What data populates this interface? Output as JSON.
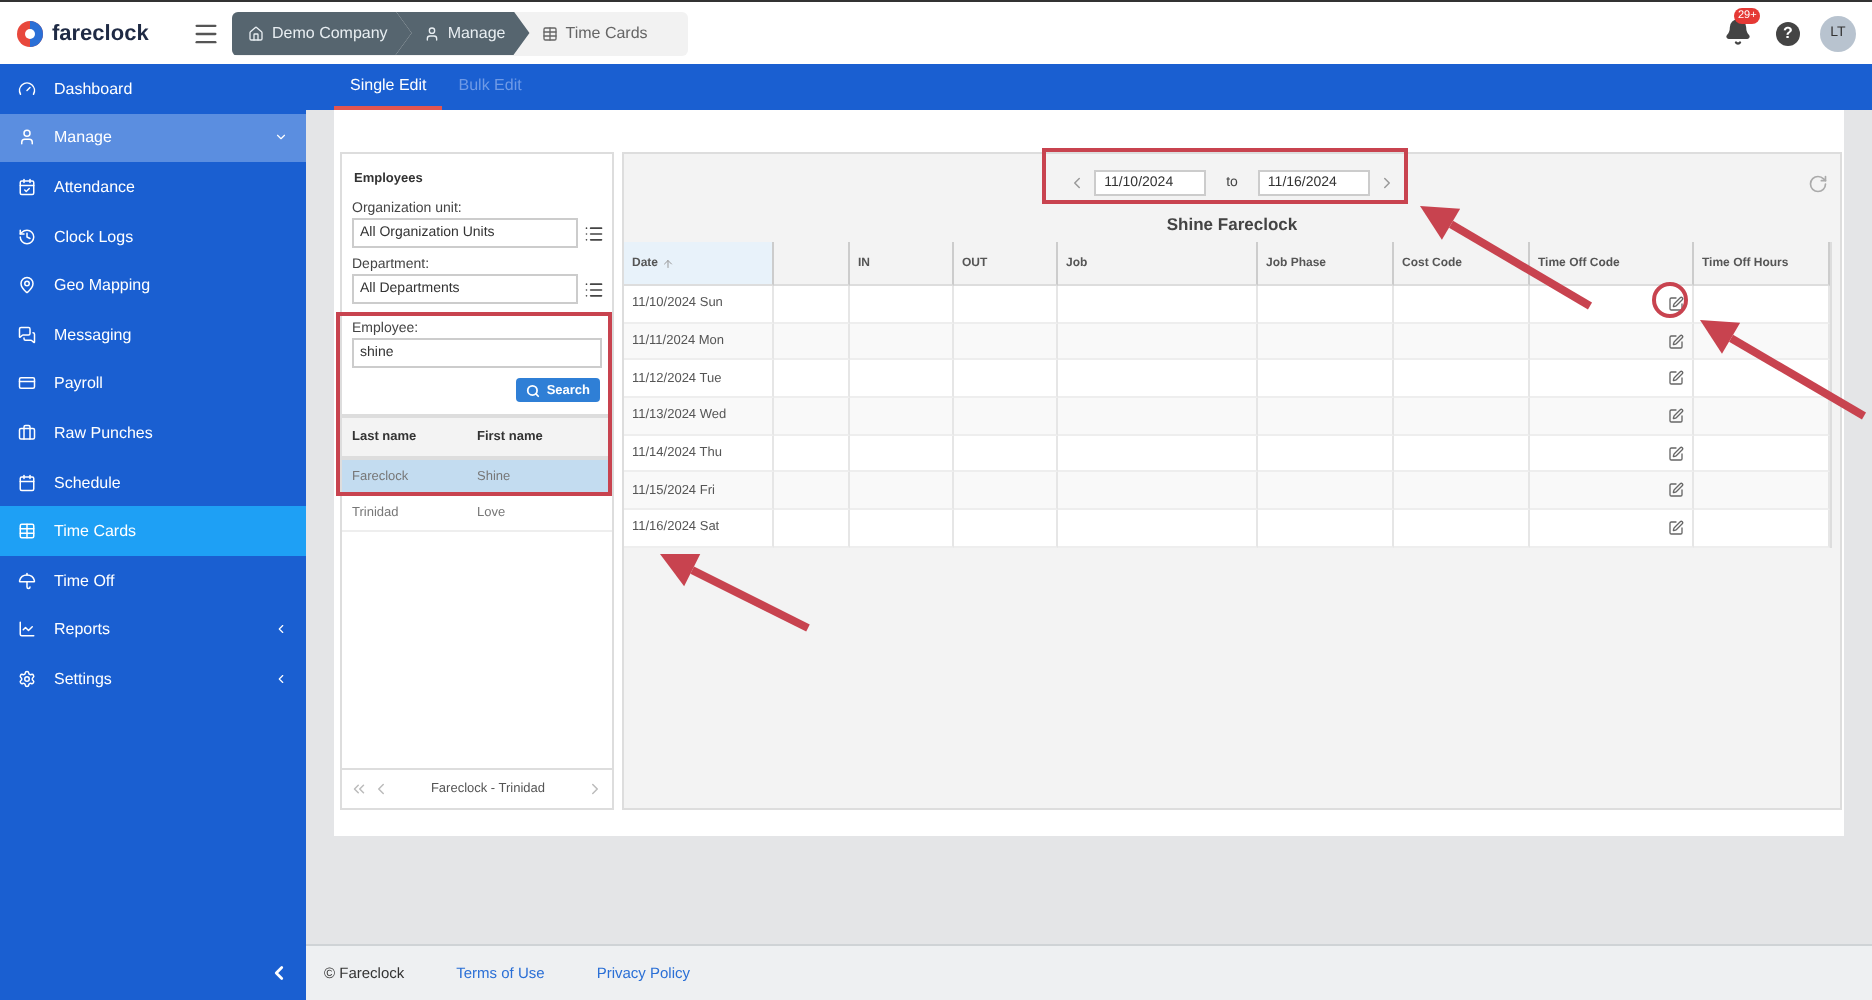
{
  "app": {
    "name": "fareclock"
  },
  "breadcrumbs": [
    {
      "label": "Demo Company",
      "selected": false
    },
    {
      "label": "Manage",
      "selected": false
    },
    {
      "label": "Time Cards",
      "selected": true
    }
  ],
  "header": {
    "notifications": "29+",
    "help": "?",
    "avatar": "LT"
  },
  "sidebar": {
    "items": [
      {
        "label": "Dashboard",
        "kind": "link",
        "selected": false
      },
      {
        "label": "Manage",
        "kind": "group",
        "expanded": true,
        "selected": false
      },
      {
        "label": "Attendance",
        "kind": "link",
        "selected": false
      },
      {
        "label": "Clock Logs",
        "kind": "link",
        "selected": false
      },
      {
        "label": "Geo Mapping",
        "kind": "link",
        "selected": false
      },
      {
        "label": "Messaging",
        "kind": "link",
        "selected": false
      },
      {
        "label": "Payroll",
        "kind": "link",
        "selected": false
      },
      {
        "label": "Raw Punches",
        "kind": "link",
        "selected": false
      },
      {
        "label": "Schedule",
        "kind": "link",
        "selected": false
      },
      {
        "label": "Time Cards",
        "kind": "link",
        "selected": true
      },
      {
        "label": "Time Off",
        "kind": "link",
        "selected": false
      },
      {
        "label": "Reports",
        "kind": "group",
        "expanded": false,
        "selected": false
      },
      {
        "label": "Settings",
        "kind": "group",
        "expanded": false,
        "selected": false
      }
    ]
  },
  "tabs": [
    {
      "label": "Single Edit",
      "selected": true
    },
    {
      "label": "Bulk Edit",
      "selected": false
    }
  ],
  "employees": {
    "title": "Employees",
    "org_unit": {
      "label": "Organization unit:",
      "value": "All Organization Units"
    },
    "department": {
      "label": "Department:",
      "value": "All Departments"
    },
    "employee": {
      "label": "Employee:",
      "value": "shine"
    },
    "search_button": "Search",
    "columns": [
      "Last name",
      "First name"
    ],
    "rows": [
      {
        "last": "Fareclock",
        "first": "Shine",
        "selected": true
      },
      {
        "last": "Trinidad",
        "first": "Love",
        "selected": false
      }
    ],
    "pager": "Fareclock - Trinidad"
  },
  "timecard": {
    "from": "11/10/2024",
    "to_label": "to",
    "to": "11/16/2024",
    "title": "Shine Fareclock",
    "columns": [
      {
        "label": "Date",
        "sorted": true,
        "kind": "date"
      },
      {
        "sorted": false,
        "kind": "text"
      },
      {
        "label": "IN",
        "sorted": false,
        "kind": "text"
      },
      {
        "label": "OUT",
        "sorted": false,
        "kind": "text"
      },
      {
        "label": "Job",
        "sorted": false,
        "kind": "text"
      },
      {
        "label": "Job Phase",
        "sorted": false,
        "kind": "text"
      },
      {
        "label": "Cost Code",
        "sorted": false,
        "kind": "text"
      },
      {
        "label": "Time Off Code",
        "sorted": false,
        "kind": "edit"
      },
      {
        "label": "Time Off Hours",
        "sorted": false,
        "kind": "text"
      }
    ],
    "rows": [
      {
        "date": "11/10/2024 Sun"
      },
      {
        "date": "11/11/2024 Mon"
      },
      {
        "date": "11/12/2024 Tue"
      },
      {
        "date": "11/13/2024 Wed"
      },
      {
        "date": "11/14/2024 Thu"
      },
      {
        "date": "11/15/2024 Fri"
      },
      {
        "date": "11/16/2024 Sat"
      }
    ]
  },
  "footer": {
    "copyright": "© Fareclock",
    "links": [
      "Terms of Use",
      "Privacy Policy"
    ]
  }
}
